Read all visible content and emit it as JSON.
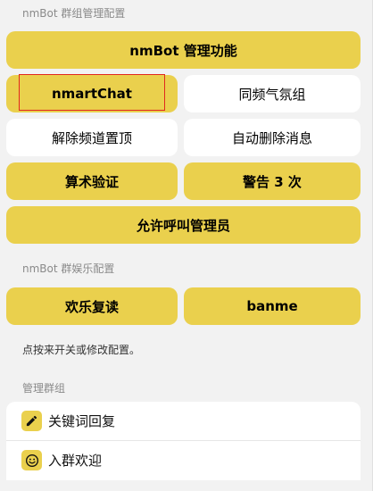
{
  "sections": {
    "manage_label": "nmBot 群组管理配置",
    "fun_label": "nmBot 群娱乐配置",
    "group_label": "管理群组"
  },
  "manage_buttons": {
    "main": {
      "label": "nmBot 管理功能",
      "state": "on"
    },
    "nmartchat": {
      "label": "nmartChat",
      "state": "on",
      "focused": true
    },
    "same_frequency": {
      "label": "同频气氛组",
      "state": "off"
    },
    "unpin": {
      "label": "解除频道置顶",
      "state": "off"
    },
    "auto_delete": {
      "label": "自动删除消息",
      "state": "off"
    },
    "math_verify": {
      "label": "算术验证",
      "state": "on"
    },
    "warn_three": {
      "label": "警告 3 次",
      "state": "on"
    },
    "allow_call_admin": {
      "label": "允许呼叫管理员",
      "state": "on"
    }
  },
  "fun_buttons": {
    "repeat": {
      "label": "欢乐复读",
      "state": "on"
    },
    "banme": {
      "label": "banme",
      "state": "on"
    }
  },
  "hint": "点按来开关或修改配置。",
  "group_items": [
    {
      "label": "关键词回复",
      "icon": "pencil-icon"
    },
    {
      "label": "入群欢迎",
      "icon": "smiley-icon"
    }
  ],
  "colors": {
    "enabled": "#ead04d",
    "disabled": "#ffffff",
    "background": "#f2f2f2",
    "focus": "#e1281e"
  }
}
